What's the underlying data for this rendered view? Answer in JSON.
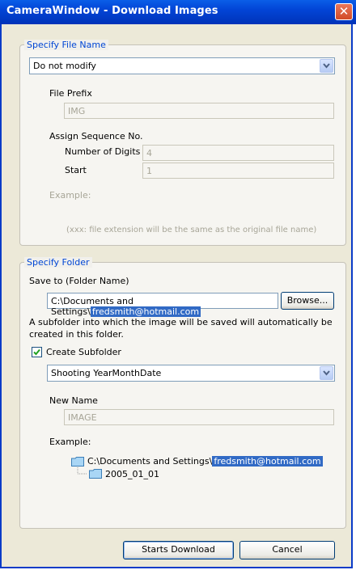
{
  "window": {
    "title": "CameraWindow - Download Images"
  },
  "file_name_group": {
    "legend": "Specify File Name",
    "mode_value": "Do not modify",
    "prefix_label": "File Prefix",
    "prefix_value": "IMG",
    "sequence_label": "Assign Sequence No.",
    "digits_label": "Number of Digits",
    "digits_value": "4",
    "start_label": "Start",
    "start_value": "1",
    "example_label": "Example:",
    "example_note": "(xxx: file extension will be the same as the original file name)"
  },
  "folder_group": {
    "legend": "Specify Folder",
    "save_to_label": "Save to (Folder Name)",
    "path_prefix": "C:\\Documents and Settings\\",
    "path_user": "fredsmith@hotmail.com",
    "browse_label": "Browse...",
    "info_text_1": "A subfolder into which the image will be saved will automatically be",
    "info_text_2": "created in this folder.",
    "create_subfolder_label": "Create Subfolder",
    "create_subfolder_checked": true,
    "subfolder_mode_value": "Shooting YearMonthDate",
    "new_name_label": "New Name",
    "new_name_value": "IMAGE",
    "example_label": "Example:",
    "example_path_prefix": "C:\\Documents and Settings\\",
    "example_path_user": "fredsmith@hotmail.com",
    "example_subfolder": "2005_01_01"
  },
  "footer": {
    "start_download_label": "Starts Download",
    "cancel_label": "Cancel"
  },
  "colors": {
    "title_bar": "#0245d6",
    "legend_text": "#0046d5",
    "selection": "#316ac5",
    "close_button": "#d24a26"
  }
}
